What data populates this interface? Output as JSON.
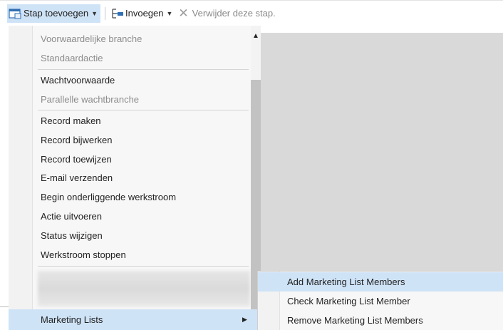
{
  "toolbar": {
    "add_step_label": "Stap toevoegen",
    "insert_label": "Invoegen",
    "delete_label": "Verwijder deze stap."
  },
  "menu": {
    "group1": [
      "Voorwaardelijke branche",
      "Standaardactie"
    ],
    "group2": [
      "Wachtvoorwaarde",
      "Parallelle wachtbranche"
    ],
    "group3": [
      "Record maken",
      "Record bijwerken",
      "Record toewijzen",
      "E-mail verzenden",
      "Begin onderliggende werkstroom",
      "Actie uitvoeren",
      "Status wijzigen",
      "Werkstroom stoppen"
    ],
    "marketing_lists": "Marketing Lists"
  },
  "submenu": {
    "items": [
      "Add Marketing List Members",
      "Check Marketing List Member",
      "Remove Marketing List Members"
    ]
  },
  "icons": {
    "add_step": "add-step-icon",
    "insert": "insert-icon",
    "delete": "delete-x-icon"
  }
}
